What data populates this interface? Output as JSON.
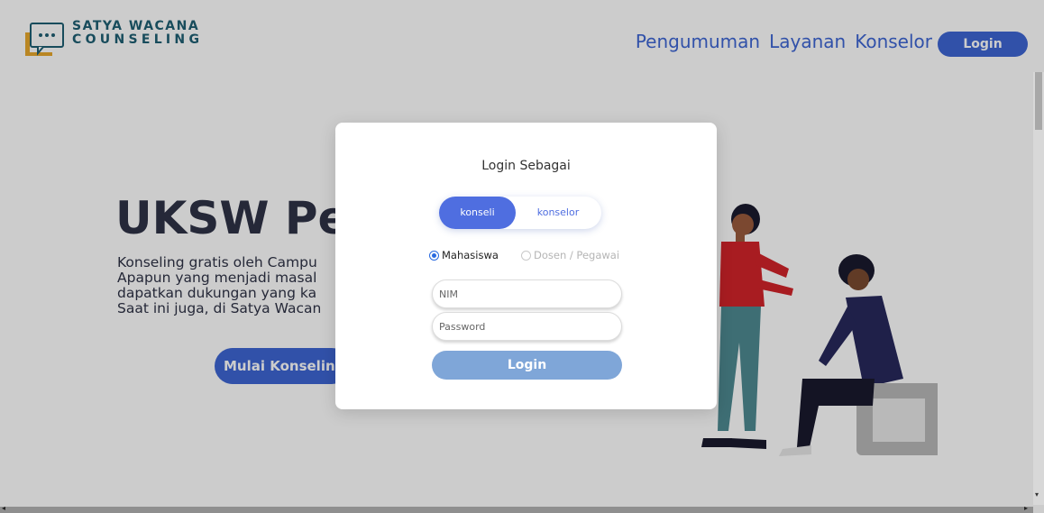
{
  "brand": {
    "line1": "SATYA WACANA",
    "line2": "COUNSELING"
  },
  "nav": {
    "links": [
      "Pengumuman",
      "Layanan",
      "Konselor"
    ],
    "login_label": "Login"
  },
  "hero": {
    "title": "UKSW Pec",
    "description_lines": [
      "Konseling gratis oleh Campu",
      "Apapun yang menjadi masal",
      "dapatkan dukungan yang ka",
      "Saat ini juga, di Satya Wacan"
    ],
    "cta_label": "Mulai Konseling"
  },
  "modal": {
    "title": "Login Sebagai",
    "toggle": {
      "active": "konseli",
      "inactive": "konselor"
    },
    "radios": [
      {
        "label": "Mahasiswa",
        "checked": true
      },
      {
        "label": "Dosen / Pegawai",
        "checked": false
      }
    ],
    "nim_placeholder": "NIM",
    "password_placeholder": "Password",
    "login_label": "Login"
  },
  "colors": {
    "brand": "#1f5f73",
    "accent": "#3e66d4",
    "toggle_active": "#4f6ee0",
    "login_button": "#7fa6d8",
    "logo_yellow": "#e8a82c"
  },
  "icons": {
    "logo": "chat-bubble-icon",
    "radio": "radio-icon"
  }
}
